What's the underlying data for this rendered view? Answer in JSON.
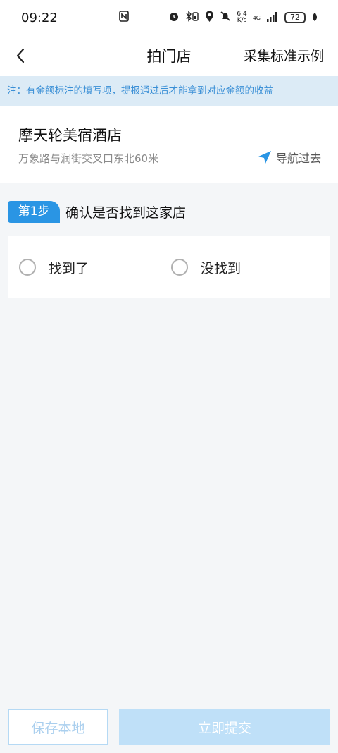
{
  "status": {
    "time": "09:22",
    "net_speed_top": "6.4",
    "net_speed_bottom": "K/s",
    "network_gen": "4G",
    "battery": "72"
  },
  "nav": {
    "title": "拍门店",
    "right_link": "采集标准示例"
  },
  "notice": "注：有金额标注的填写项，提报通过后才能拿到对应金额的收益",
  "store": {
    "name": "摩天轮美宿酒店",
    "address": "万象路与润街交叉口东北60米",
    "navigate_label": "导航过去"
  },
  "step": {
    "badge": "第1步",
    "title": "确认是否找到这家店",
    "options": [
      {
        "label": "找到了"
      },
      {
        "label": "没找到"
      }
    ]
  },
  "footer": {
    "save_label": "保存本地",
    "submit_label": "立即提交"
  },
  "colors": {
    "accent": "#2a95e4",
    "notice_bg": "#dcebf6",
    "notice_text": "#3a8fd6",
    "submit_disabled": "#bfe0f8"
  }
}
